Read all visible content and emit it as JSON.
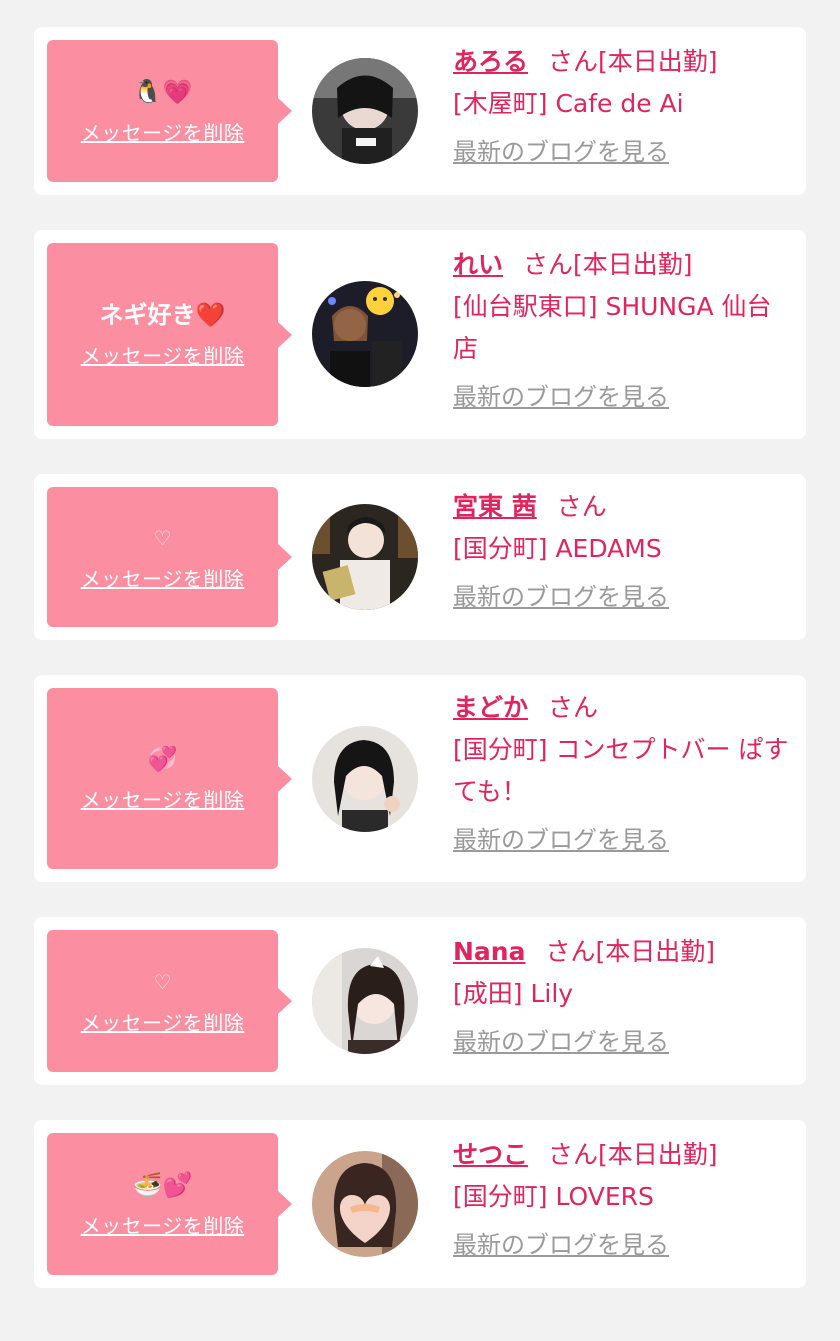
{
  "delete_label": "メッセージを削除",
  "blog_label": "最新のブログを見る",
  "san_label": "さん",
  "colors": {
    "bubble": "#fb8fa1",
    "accent": "#e0245e",
    "muted": "#9a9a9a",
    "background": "#f2f2f2"
  },
  "entries": [
    {
      "message": "🐧💗",
      "name": "あろる",
      "status": "[本日出勤]",
      "shop": "[木屋町] Cafe de Ai",
      "avatar_icon": "avatar-photo"
    },
    {
      "message": "ネギ好き❤️",
      "name": "れい",
      "status": "[本日出勤]",
      "shop": "[仙台駅東口] SHUNGA 仙台店",
      "avatar_icon": "avatar-photo"
    },
    {
      "message": "♡",
      "name": "宮東 茜",
      "status": "",
      "shop": "[国分町] AEDAMS",
      "avatar_icon": "avatar-photo"
    },
    {
      "message": "💞",
      "name": "まどか",
      "status": "",
      "shop": "[国分町] コンセプトバー ぱすても！",
      "avatar_icon": "avatar-photo"
    },
    {
      "message": "♡",
      "name": "Nana",
      "status": "[本日出勤]",
      "shop": "[成田] Lily",
      "avatar_icon": "avatar-photo"
    },
    {
      "message": "🍜💕",
      "name": "せつこ",
      "status": "[本日出勤]",
      "shop": "[国分町] LOVERS",
      "avatar_icon": "avatar-photo"
    }
  ]
}
